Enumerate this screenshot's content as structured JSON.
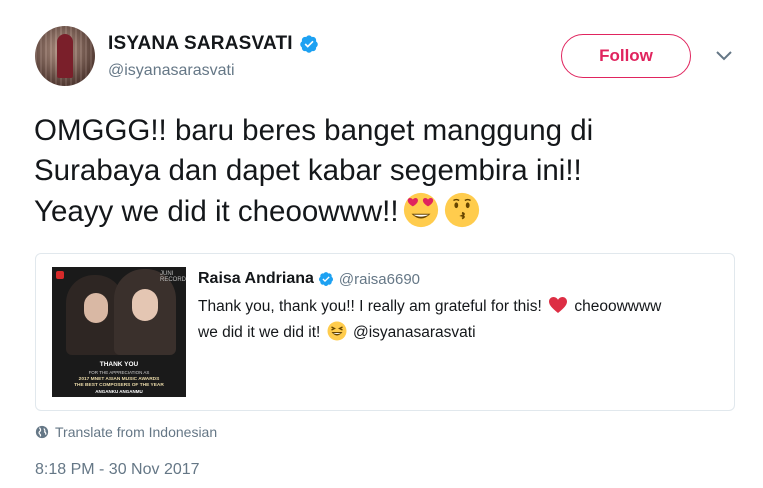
{
  "author": {
    "name": "ISYANA SARASVATI",
    "handle": "@isyanasarasvati"
  },
  "follow_label": "Follow",
  "tweet": {
    "line1": "OMGGG!! baru beres banget manggung di",
    "line2": "Surabaya dan dapet kabar segembira ini!!",
    "line3": "Yeayy we did it cheoowww!!",
    "emojis": [
      "heart-eyes-emoji",
      "kissing-emoji"
    ]
  },
  "quote": {
    "name": "Raisa Andriana",
    "handle": "@raisa6690",
    "text_part1": "Thank you, thank you!! I really am grateful for this!",
    "text_part2": "cheoowwww",
    "text_part3": "we did it we did it!",
    "mention": "@isyanasarasvati",
    "image": {
      "label_top": "JUNI RECORDS",
      "thank_you": "THANK YOU",
      "for_text": "FOR THE APPRECIATION AS",
      "award": "2017 MNET ASIAN MUSIC AWARDS",
      "award2": "THE BEST COMPOSERS OF THE YEAR",
      "song": "ANGANKU ANGANMU",
      "artists": "RAISA & ISYANA SARASVATI"
    }
  },
  "translate_label": "Translate from Indonesian",
  "timestamp": "8:18 PM - 30 Nov 2017",
  "colors": {
    "follow": "#e0245e",
    "verified": "#1da1f2",
    "muted": "#657786",
    "border": "#e1e8ed"
  }
}
